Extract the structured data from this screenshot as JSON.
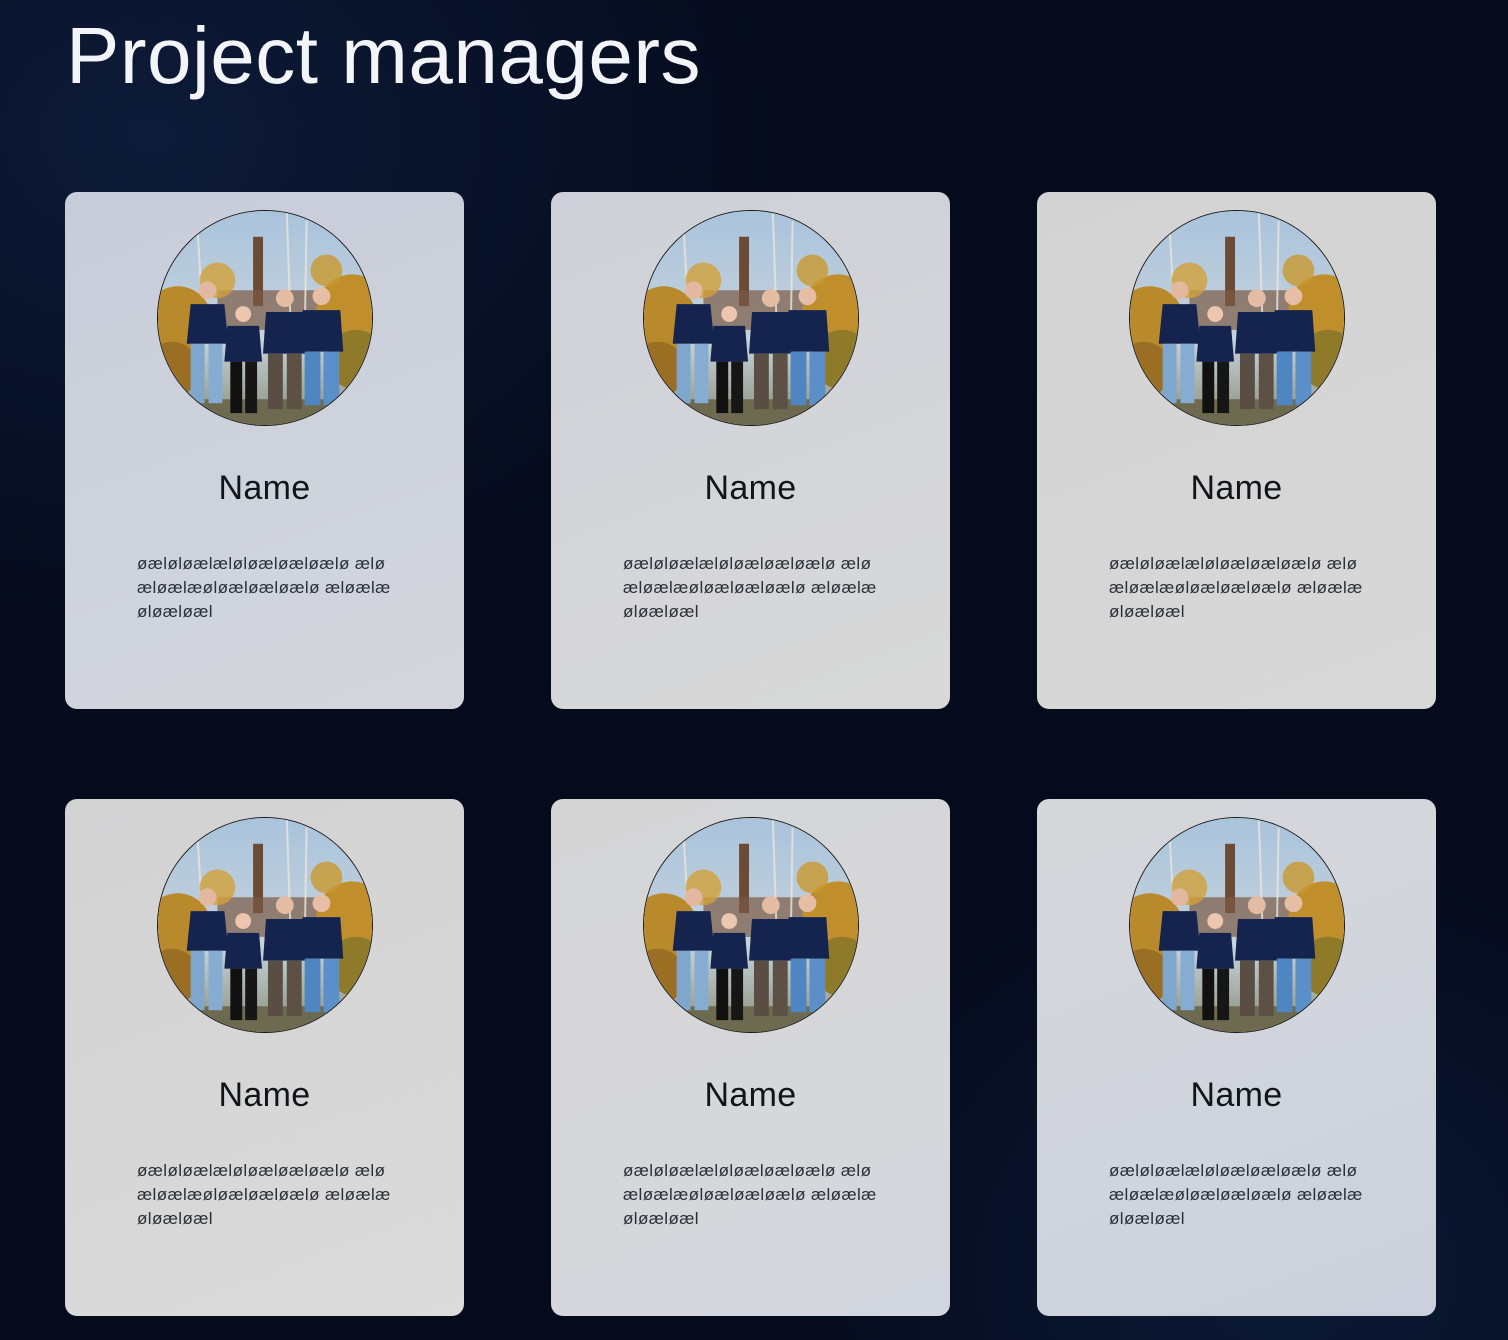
{
  "page": {
    "title": "Project managers"
  },
  "cards": [
    {
      "name": "Name",
      "bio": "øæløløælæløløæløæløælø æløæløælæøløæløæløælø æløælæøløæløæl",
      "photo_icon": "team-photo"
    },
    {
      "name": "Name",
      "bio": "øæløløælæløløæløæløælø æløæløælæøløæløæløælø æløælæøløæløæl",
      "photo_icon": "team-photo"
    },
    {
      "name": "Name",
      "bio": "øæløløælæløløæløæløælø æløæløælæøløæløæløælø æløælæøløæløæl",
      "photo_icon": "team-photo"
    },
    {
      "name": "Name",
      "bio": "øæløløælæløløæløæløælø æløæløælæøløæløæløælø æløælæøløæløæl",
      "photo_icon": "team-photo"
    },
    {
      "name": "Name",
      "bio": "øæløløælæløløæløæløælø æløæløælæøløæløæløælø æløælæøløæløæl",
      "photo_icon": "team-photo"
    },
    {
      "name": "Name",
      "bio": "øæløløælæløløæløæløælø æløæløælæøløæløæløælø æløælæøløæløæl",
      "photo_icon": "team-photo"
    }
  ],
  "colors": {
    "background": "#050b1c",
    "title": "#f2f4f8",
    "card": "#d6d7da",
    "text": "#111418"
  }
}
